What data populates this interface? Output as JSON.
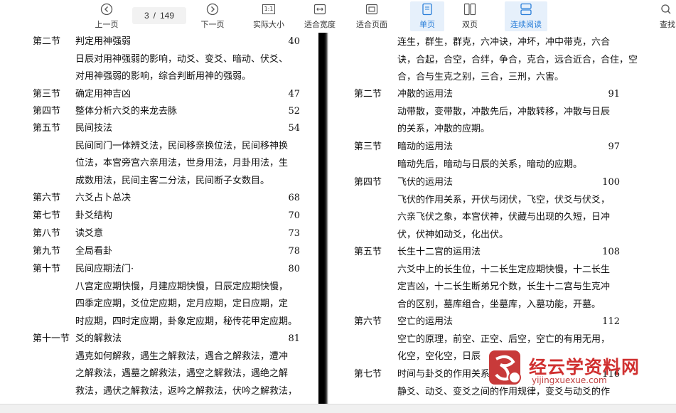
{
  "toolbar": {
    "prev_label": "上一页",
    "page_current": "3",
    "page_sep": "/",
    "page_total": "149",
    "next_label": "下一页",
    "actual_size_label": "实际大小",
    "actual_size_icon_text": "1:1",
    "fit_width_label": "适合宽度",
    "fit_page_label": "适合页面",
    "single_page_label": "单页",
    "double_page_label": "双页",
    "continuous_label": "连续阅读",
    "search_label": "查找",
    "active_color": "#2b7fd9"
  },
  "left_page": {
    "entries": [
      {
        "section": "第二节",
        "title": "判定用神强弱",
        "page": "40",
        "desc": [
          "日辰对用神强弱的影响，动爻、变爻、暗动、伏爻、",
          "对用神强弱的影响，综合判断用神的强弱。"
        ]
      },
      {
        "section": "第三节",
        "title": "确定用神吉凶",
        "page": "47",
        "desc": []
      },
      {
        "section": "第四节",
        "title": "整体分析六爻的来龙去脉",
        "page": "52",
        "desc": []
      },
      {
        "section": "第五节",
        "title": "民间技法",
        "page": "54",
        "desc": [
          "民间同门一体辨爻法，民间移亲换位法，民间移神换",
          "位法，本宫旁宫六亲用法，世身用法，月卦用法，生",
          "成数用法，民间主客二分法，民间断子女数目。"
        ]
      },
      {
        "section": "第六节",
        "title": "六爻占卜总决",
        "page": "68",
        "desc": []
      },
      {
        "section": "第七节",
        "title": "卦爻结构",
        "page": "70",
        "desc": []
      },
      {
        "section": "第八节",
        "title": "读爻意",
        "page": "73",
        "desc": []
      },
      {
        "section": "第九节",
        "title": "全局看卦",
        "page": "78",
        "desc": []
      },
      {
        "section": "第十节",
        "title": "民间应期法门·",
        "page": "80",
        "desc": [
          "八宫定应期快慢，月建应期快慢，日辰定应期快慢，",
          "四季定应期，爻位定应期，定月应期，定日应期，定",
          "时应期，四时定应期，卦象定应期，秘传花甲定应期。"
        ]
      },
      {
        "section": "第十一节",
        "title": "爻的解救法",
        "page": "81",
        "desc": [
          "遇克如何解救，遇生之解救法，遇合之解救法，遭冲",
          "之解救法，遇墓之解救法，遇空之解救法，遇绝之解",
          "救法，遇伏之解救法，返吟之解救法，伏吟之解救法，"
        ]
      }
    ]
  },
  "right_page": {
    "top_desc": [
      "连生，群生，群克，六冲诀，冲坏，冲中带克，六合",
      "诀，合起，合空，合绊，争合，克合，远合近合，合住，空",
      "合，合与生克之别，三合，三刑，六害。"
    ],
    "entries": [
      {
        "section": "第二节",
        "title": "冲散的运用法",
        "page": "91",
        "desc": [
          "动带散，变带散，冲散先后，冲散转移，冲散与日辰",
          "的关系，冲散的应期。"
        ]
      },
      {
        "section": "第三节",
        "title": "暗动的运用法",
        "page": "97",
        "desc": [
          "暗动先后，暗动与日辰的关系，暗动的应期。"
        ]
      },
      {
        "section": "第四节",
        "title": "飞伏的运用法",
        "page": "100",
        "desc": [
          "飞伏的作用关系，开伏与闭伏，飞空，伏爻与伏爻，",
          "六亲飞伏之象，本宫伏神，伏藏与出现的久短，日冲",
          "伏，伏神如动爻，化出伏。"
        ]
      },
      {
        "section": "第五节",
        "title": "长生十二宫的运用法",
        "page": "108",
        "desc": [
          "六爻中上的长生位，十二长生定应期快慢，十二长生",
          "定吉凶，十二长生断弟兄个数，长生十二宫与生克冲",
          "合的区别，墓库组合，坐墓库，入墓功能，开墓。"
        ]
      },
      {
        "section": "第六节",
        "title": "空亡的运用法",
        "page": "112",
        "desc": [
          "空亡的原理，前空、正空、后空，空亡的有用无用，",
          "化空，空化空，日辰"
        ]
      },
      {
        "section": "第七节",
        "title": "时间与卦爻的作用关系",
        "page": "116",
        "desc": [
          "静爻、动爻、变爻之间的作用规律，变爻与动爻的作"
        ]
      }
    ]
  },
  "watermark": {
    "text": "经云学资料网",
    "sub": "yijingxuexue.com",
    "color": "#d03030"
  }
}
